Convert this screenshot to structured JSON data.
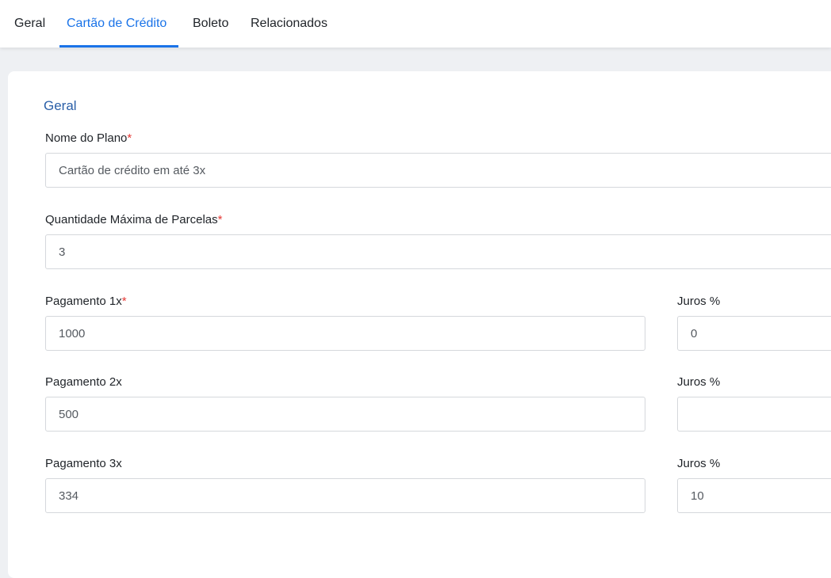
{
  "tabs": [
    {
      "label": "Geral",
      "active": false
    },
    {
      "label": "Cartão de Crédito",
      "active": true
    },
    {
      "label": "Boleto",
      "active": false
    },
    {
      "label": "Relacionados",
      "active": false
    }
  ],
  "section": {
    "title": "Geral"
  },
  "form": {
    "required_mark": "*",
    "plan_name": {
      "label": "Nome do Plano",
      "value": "Cartão de crédito em até 3x"
    },
    "max_installments": {
      "label": "Quantidade Máxima de Parcelas",
      "value": "3"
    },
    "payments": [
      {
        "label": "Pagamento 1x",
        "value": "1000",
        "interest_label": "Juros %",
        "interest_value": "0"
      },
      {
        "label": "Pagamento 2x",
        "value": "500",
        "interest_label": "Juros %",
        "interest_value": ""
      },
      {
        "label": "Pagamento 3x",
        "value": "334",
        "interest_label": "Juros %",
        "interest_value": "10"
      }
    ]
  },
  "colors": {
    "accent": "#1a73e8",
    "section_title": "#2a5fa8",
    "required": "#e53935",
    "background": "#eef0f3"
  }
}
